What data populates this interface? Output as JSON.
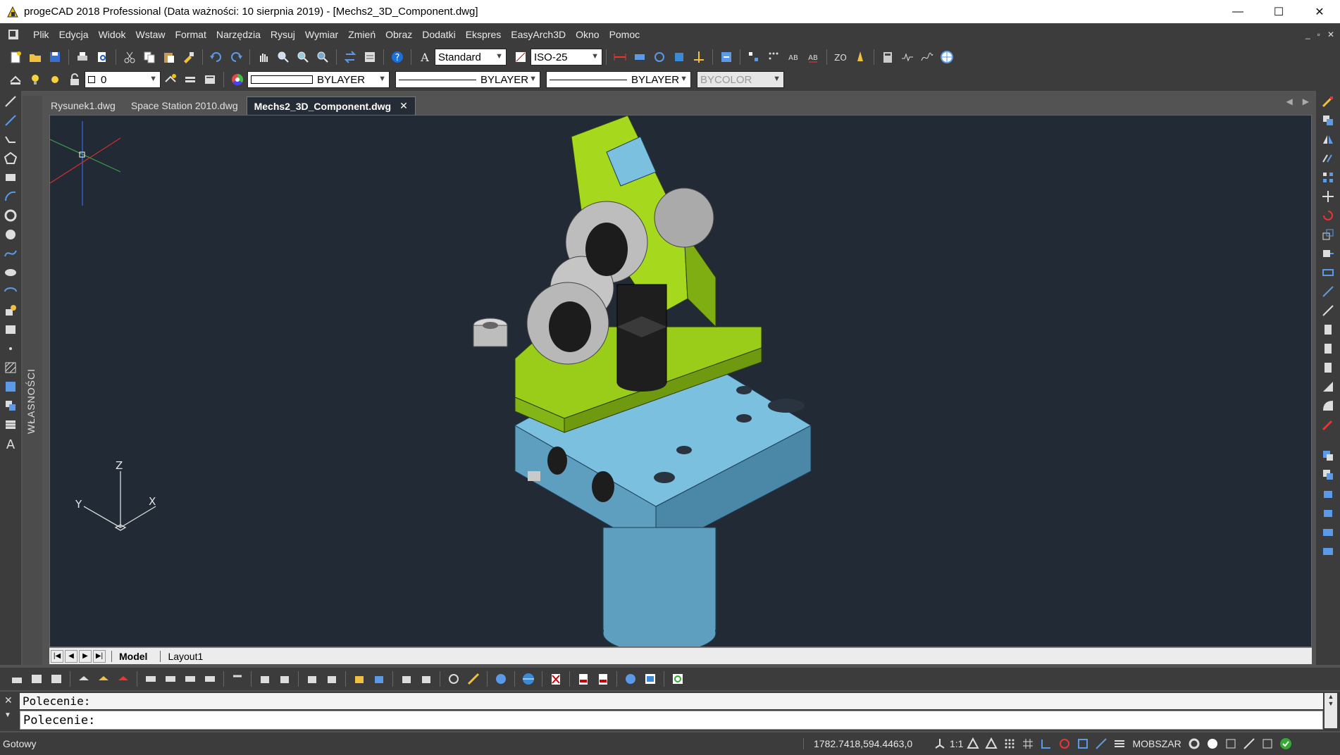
{
  "window": {
    "title": "progeCAD 2018 Professional  (Data ważności: 10 sierpnia 2019) - [Mechs2_3D_Component.dwg]",
    "min": "—",
    "max": "☐",
    "close": "✕"
  },
  "menu": {
    "items": [
      "Plik",
      "Edycja",
      "Widok",
      "Wstaw",
      "Format",
      "Narzędzia",
      "Rysuj",
      "Wymiar",
      "Zmień",
      "Obraz",
      "Dodatki",
      "Ekspres",
      "EasyArch3D",
      "Okno",
      "Pomoc"
    ],
    "mdi": [
      "_",
      "▫",
      "✕"
    ]
  },
  "toolbar1": {
    "text_style": "Standard",
    "dim_style": "ISO-25"
  },
  "toolbar2": {
    "layer": "0",
    "color": "BYLAYER",
    "linetype": "BYLAYER",
    "lineweight": "BYLAYER",
    "plotstyle": "BYCOLOR"
  },
  "side": {
    "properties_label": "WŁASNOŚCI"
  },
  "tabs": {
    "items": [
      "Rysunek1.dwg",
      "Space Station 2010.dwg",
      "Mechs2_3D_Component.dwg"
    ],
    "active": 2,
    "close": "✕",
    "nav_left": "◀",
    "nav_right": "▶"
  },
  "viewport": {
    "ucs_labels": {
      "z": "Z",
      "y": "Y",
      "x": "X"
    },
    "colors": {
      "background": "#222a35",
      "base_blue": "#6aaccc",
      "bracket_green": "#9acd1a",
      "link_gray": "#b8b8b8",
      "dark": "#1c1c1c"
    }
  },
  "layout": {
    "nav": [
      "|◀",
      "◀",
      "▶",
      "▶|"
    ],
    "tabs": [
      "Model",
      "Layout1"
    ],
    "active": 0
  },
  "command": {
    "history": "Polecenie:",
    "prompt": "Polecenie:",
    "close": "✕",
    "chevron": "▼",
    "scroll_up": "▲",
    "scroll_down": "▼"
  },
  "status": {
    "state": "Gotowy",
    "coords": "1782.7418,594.4463,0",
    "scale": "1:1",
    "space": "MOBSZAR"
  }
}
